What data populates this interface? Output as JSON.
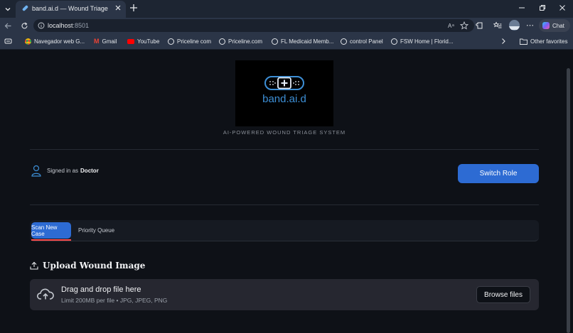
{
  "browser": {
    "tab_title": "band.ai.d — Wound Triage",
    "url_host": "localhost",
    "url_port": ":8501",
    "chat_label": "Chat",
    "favorites": [
      {
        "label": "Navegador web G...",
        "icon": "chrome-icon"
      },
      {
        "label": "Gmail",
        "icon": "gmail-icon"
      },
      {
        "label": "YouTube",
        "icon": "youtube-icon"
      },
      {
        "label": "Priceline com",
        "icon": "globe-icon"
      },
      {
        "label": "Priceline.com",
        "icon": "globe-icon"
      },
      {
        "label": "FL Medicaid Memb...",
        "icon": "globe-icon"
      },
      {
        "label": "control Panel",
        "icon": "globe-icon"
      },
      {
        "label": "FSW Home | Florid...",
        "icon": "globe-icon"
      }
    ],
    "other_favorites": "Other favorites"
  },
  "app": {
    "logo_text": "band.ai.d",
    "subtitle": "AI-POWERED WOUND TRIAGE SYSTEM",
    "signed_in_prefix": "Signed in as",
    "signed_in_role": "Doctor",
    "switch_role_label": "Switch Role",
    "tabs": [
      "Scan New Case",
      "Priority Queue"
    ],
    "active_tab": "Scan New Case",
    "upload_heading": "Upload Wound Image",
    "drop_title": "Drag and drop file here",
    "drop_limits": "Limit 200MB per file • JPG, JPEG, PNG",
    "browse_label": "Browse files"
  },
  "colors": {
    "accent": "#2d6bd3",
    "active_underline": "#ff4b4b",
    "page_bg": "#0e1117",
    "browser_chrome": "#2b3547",
    "logo_blue": "#3d8fd6"
  }
}
